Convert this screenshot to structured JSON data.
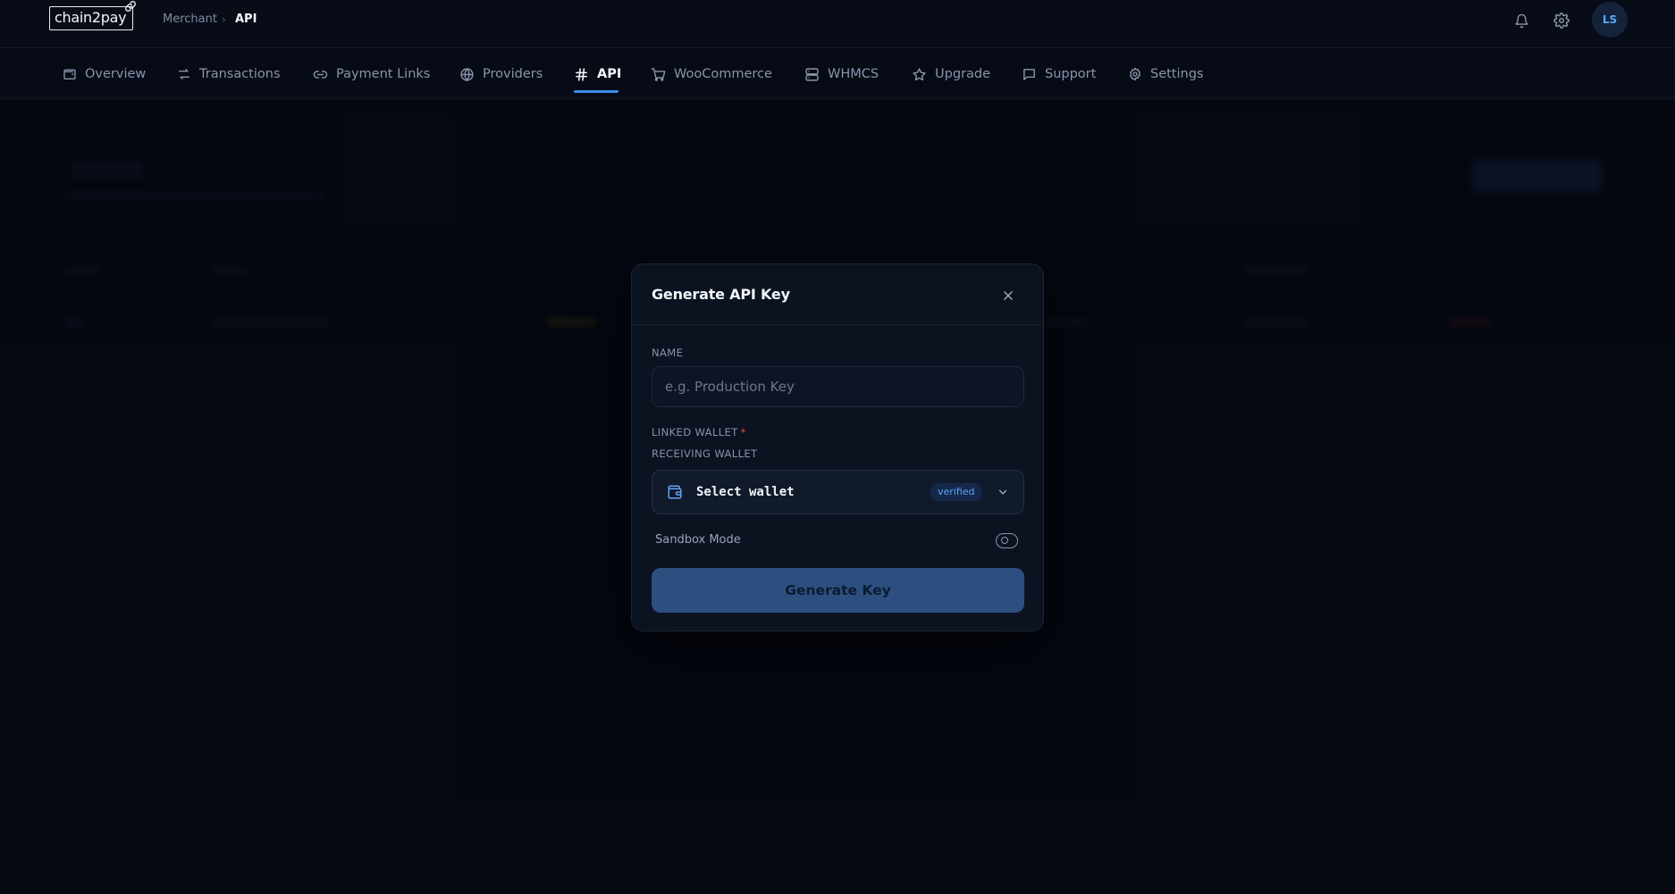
{
  "brand": {
    "logo_text": "chain2pay"
  },
  "breadcrumb": {
    "parent": "Merchant",
    "separator": "›",
    "current": "API"
  },
  "user": {
    "initials": "LS"
  },
  "nav": {
    "items": [
      {
        "label": "Overview",
        "icon": "wallet-icon"
      },
      {
        "label": "Transactions",
        "icon": "arrows-swap-icon"
      },
      {
        "label": "Payment Links",
        "icon": "link-icon"
      },
      {
        "label": "Providers",
        "icon": "globe-icon"
      },
      {
        "label": "API",
        "icon": "hash-icon",
        "active": true
      },
      {
        "label": "WooCommerce",
        "icon": "cart-icon"
      },
      {
        "label": "WHMCS",
        "icon": "server-icon"
      },
      {
        "label": "Upgrade",
        "icon": "star-icon"
      },
      {
        "label": "Support",
        "icon": "message-icon"
      },
      {
        "label": "Settings",
        "icon": "gear-icon"
      }
    ]
  },
  "modal": {
    "title": "Generate API Key",
    "name_label": "NAME",
    "name_placeholder": "e.g. Production Key",
    "name_value": "",
    "linked_wallet_label": "LINKED WALLET",
    "required_mark": "*",
    "receiving_wallet_label": "RECEIVING WALLET",
    "wallet_select_text": "Select wallet",
    "wallet_badge": "verified",
    "sandbox_label": "Sandbox Mode",
    "sandbox_enabled": false,
    "generate_button": "Generate Key"
  },
  "colors": {
    "background": "#050a14",
    "accent": "#3b8ff0",
    "primary_button": "#2d4f80",
    "required": "#e5484d",
    "badge_text": "#5ea3f5"
  }
}
